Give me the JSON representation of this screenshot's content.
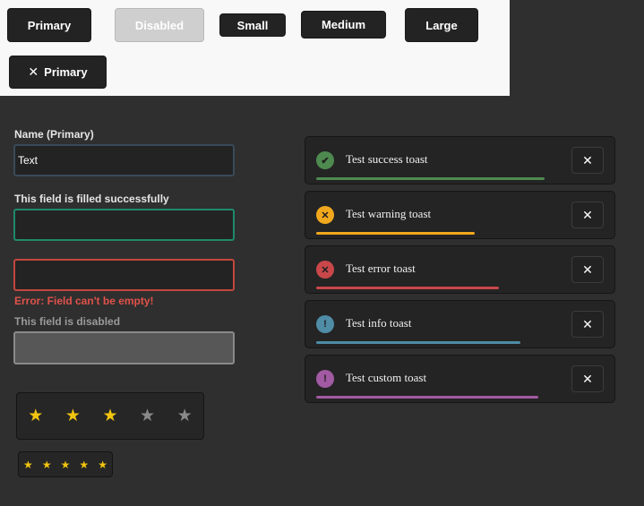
{
  "buttons": {
    "primary": "Primary",
    "disabled": "Disabled",
    "small": "Small",
    "medium": "Medium",
    "large": "Large",
    "icon_primary": "Primary",
    "icon_symbol": "✕"
  },
  "form": {
    "name_label": "Name (Primary)",
    "name_value": "Text",
    "success_label": "This field is filled successfully",
    "success_value": "",
    "error_value": "",
    "error_message": "Error: Field can't be empty!",
    "disabled_label": "This field is disabled",
    "disabled_value": ""
  },
  "ratings": [
    {
      "value": 3,
      "max": 5,
      "star_glyph": "★"
    },
    {
      "value": 5,
      "max": 5,
      "star_glyph": "★"
    }
  ],
  "toasts": [
    {
      "type": "success",
      "message": "Test success toast",
      "icon": "check-icon",
      "glyph": "✔",
      "color": "#4e8a4f",
      "progress": 0.75,
      "close": "✕"
    },
    {
      "type": "warning",
      "message": "Test warning toast",
      "icon": "x-circle-icon",
      "glyph": "✕",
      "color": "#f2a81d",
      "progress": 0.52,
      "close": "✕"
    },
    {
      "type": "error",
      "message": "Test error toast",
      "icon": "x-circle-icon",
      "glyph": "✕",
      "color": "#c9474a",
      "progress": 0.6,
      "close": "✕"
    },
    {
      "type": "info",
      "message": "Test info toast",
      "icon": "info-icon",
      "glyph": "!",
      "color": "#4f8ca6",
      "progress": 0.67,
      "close": "✕"
    },
    {
      "type": "custom",
      "message": "Test custom toast",
      "icon": "exclamation-icon",
      "glyph": "!",
      "color": "#a25aa3",
      "progress": 0.73,
      "close": "✕"
    }
  ]
}
